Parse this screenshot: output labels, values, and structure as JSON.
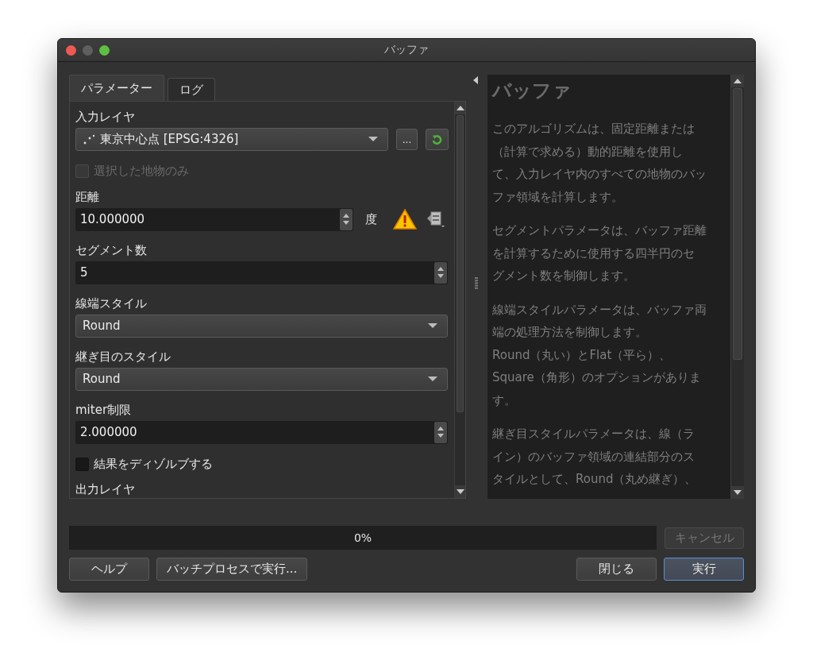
{
  "window": {
    "title": "バッファ"
  },
  "tabs": [
    {
      "label": "パラメーター",
      "selected": true
    },
    {
      "label": "ログ",
      "selected": false
    }
  ],
  "params": [
    {
      "kind": "layer",
      "label": "入力レイヤ",
      "value": "東京中心点 [EPSG:4326]",
      "button": "..."
    },
    {
      "kind": "checkbox",
      "label": "選択した地物のみ",
      "checked": false,
      "disabled": true
    },
    {
      "kind": "distance",
      "label": "距離",
      "value": "10.000000",
      "unit": "度"
    },
    {
      "kind": "spin",
      "label": "セグメント数",
      "value": "5"
    },
    {
      "kind": "combo",
      "label": "線端スタイル",
      "value": "Round"
    },
    {
      "kind": "combo",
      "label": "継ぎ目のスタイル",
      "value": "Round"
    },
    {
      "kind": "spin",
      "label": "miter制限",
      "value": "2.000000"
    },
    {
      "kind": "checkbox",
      "label": "結果をディゾルブする",
      "checked": false,
      "disabled": false
    },
    {
      "kind": "heading",
      "label": "出力レイヤ"
    }
  ],
  "help": {
    "title": "バッファ",
    "paragraphs": [
      [
        "このアルゴリズムは、固定距離または",
        "（計算で求める）動的距離を使用し",
        "て、入力レイヤ内のすべての地物のバッ",
        "ファ領域を計算します。"
      ],
      [
        "セグメントパラメータは、バッファ距離",
        "を計算するために使用する四半円のセ",
        "グメント数を制御します。"
      ],
      [
        "線端スタイルパラメータは、バッファ両",
        "端の処理方法を制御します。",
        "Round（丸い）とFlat（平ら）、",
        "Square（角形）のオプションがありま",
        "す。"
      ],
      [
        "継ぎ目スタイルパラメータは、線（ラ",
        "イン）のバッファ領域の連結部分のス",
        "タイルとして、Round（丸め継ぎ）、"
      ]
    ]
  },
  "progress": {
    "level": 0,
    "label": "0%"
  },
  "cancel_button": {
    "label": "キャンセル",
    "disabled": true
  },
  "buttons": [
    {
      "label": "ヘルプ",
      "default": false
    },
    {
      "label": "バッチプロセスで実行...",
      "default": false
    },
    {
      "label": "閉じる",
      "default": false
    },
    {
      "label": "実行",
      "default": true
    }
  ]
}
